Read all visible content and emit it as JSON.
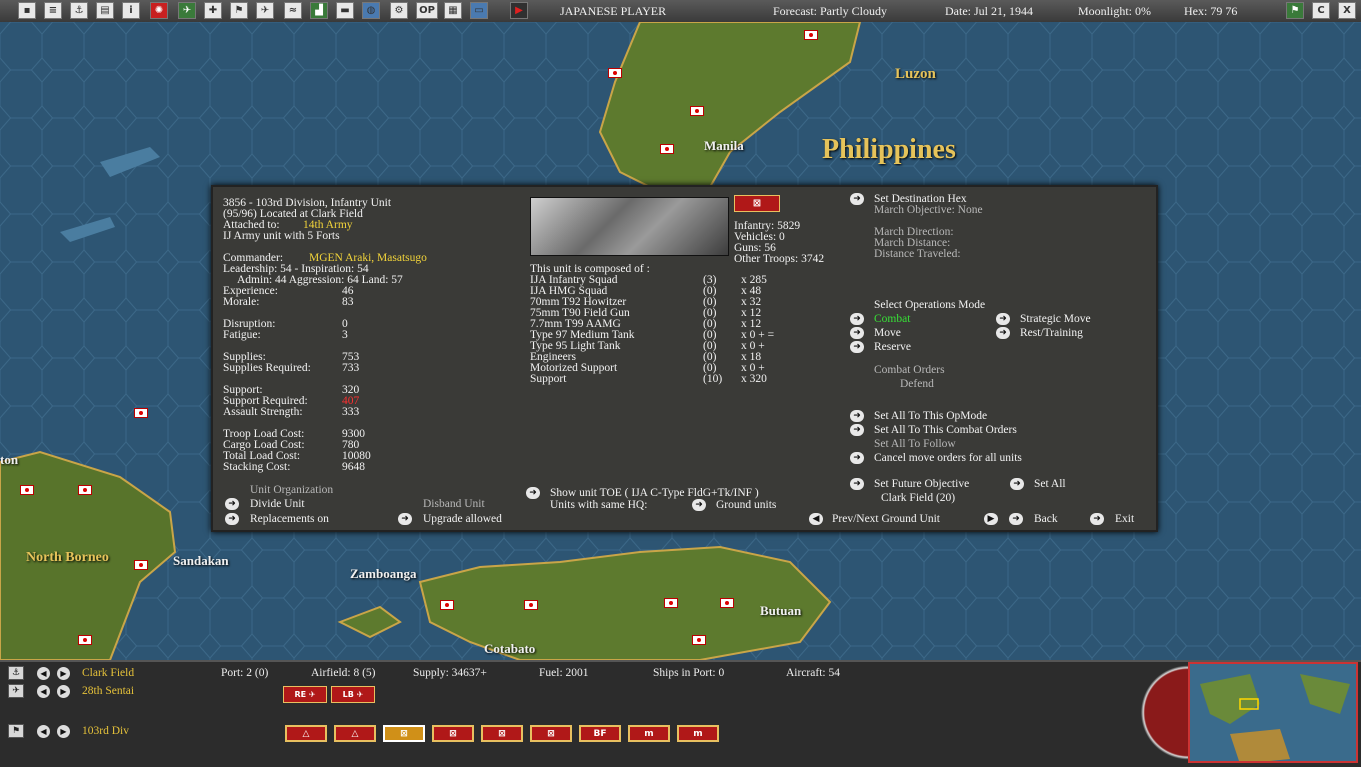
{
  "topbar": {
    "side": "JAPANESE PLAYER",
    "forecast": "Forecast: Partly Cloudy",
    "date": "Date: Jul 21, 1944",
    "moonlight": "Moonlight: 0%",
    "hex": "Hex: 79  76",
    "right_buttons": [
      "C",
      "X"
    ]
  },
  "map": {
    "region_large": "Philippines",
    "region_small": "Luzon",
    "north_borneo": "North Borneo",
    "cities": {
      "manila": "Manila",
      "sandakan": "Sandakan",
      "zamboanga": "Zamboanga",
      "butuan": "Butuan",
      "cotabato": "Cotabato",
      "ton": "ton"
    }
  },
  "unit": {
    "header": "3856 - 103rd Division, Infantry Unit",
    "location": "(95/96) Located at Clark Field",
    "attached_label": "Attached to:",
    "attached_value": "14th Army",
    "army_unit": "IJ Army unit with 5 Forts",
    "commander_label": "Commander:",
    "commander_value": "MGEN Araki, Masatsugo",
    "leadership": "Leadership: 54 - Inspiration: 54",
    "admin": "Admin: 44  Aggression: 64  Land: 57",
    "stats": [
      {
        "label": "Experience:",
        "value": "46"
      },
      {
        "label": "Morale:",
        "value": "83"
      },
      {
        "label": "Disruption:",
        "value": "0"
      },
      {
        "label": "Fatigue:",
        "value": "3"
      },
      {
        "label": "Supplies:",
        "value": "753"
      },
      {
        "label": "Supplies Required:",
        "value": "733"
      },
      {
        "label": "Support:",
        "value": "320"
      },
      {
        "label": "Support Required:",
        "value": "407"
      },
      {
        "label": "Assault Strength:",
        "value": "333"
      },
      {
        "label": "Troop Load Cost:",
        "value": "9300"
      },
      {
        "label": "Cargo Load Cost:",
        "value": "780"
      },
      {
        "label": "Total Load Cost:",
        "value": "10080"
      },
      {
        "label": "Stacking Cost:",
        "value": "9648"
      }
    ],
    "org_heading": "Unit Organization",
    "divide_unit": "Divide Unit",
    "disband_unit": "Disband Unit",
    "replacements": "Replacements on",
    "upgrade": "Upgrade allowed",
    "totals": [
      "Infantry: 5829",
      "Vehicles: 0",
      "Guns: 56",
      "Other Troops: 3742"
    ],
    "composed_heading": "This unit is composed of :",
    "composition": [
      {
        "name": "IJA Infantry Squad",
        "dis": "(3)",
        "qty": "x 285"
      },
      {
        "name": "IJA HMG Squad",
        "dis": "(0)",
        "qty": "x 48"
      },
      {
        "name": "70mm T92 Howitzer",
        "dis": "(0)",
        "qty": "x 32"
      },
      {
        "name": "75mm T90 Field Gun",
        "dis": "(0)",
        "qty": "x 12"
      },
      {
        "name": "7.7mm T99 AAMG",
        "dis": "(0)",
        "qty": "x 12"
      },
      {
        "name": "Type 97 Medium Tank",
        "dis": "(0)",
        "qty": "x 0 + ="
      },
      {
        "name": "Type 95 Light Tank",
        "dis": "(0)",
        "qty": "x 0 +"
      },
      {
        "name": "Engineers",
        "dis": "(0)",
        "qty": "x 18"
      },
      {
        "name": "Motorized Support",
        "dis": "(0)",
        "qty": "x 0 +"
      },
      {
        "name": "Support",
        "dis": "(10)",
        "qty": "x 320"
      }
    ],
    "show_toe": "Show unit TOE ( IJA C-Type FldG+Tk/INF )",
    "same_hq": "Units with same HQ:",
    "ground_units": "Ground units"
  },
  "orders": {
    "set_dest": "Set Destination Hex",
    "march_obj": "March Objective: None",
    "march_dir": "March Direction:",
    "march_dist": "March Distance:",
    "dist_trav": "Distance Traveled:",
    "select_mode": "Select Operations Mode",
    "combat": "Combat",
    "strategic": "Strategic Move",
    "move": "Move",
    "rest": "Rest/Training",
    "reserve": "Reserve",
    "combat_orders": "Combat Orders",
    "defend": "Defend",
    "set_all_opmode": "Set All To This OpMode",
    "set_all_combat": "Set All To This Combat Orders",
    "set_all_follow": "Set All To Follow",
    "cancel_move": "Cancel move orders for all units",
    "future_obj": "Set Future Objective",
    "set_all": "Set All",
    "clark_field": "Clark Field (20)",
    "prev_next": "Prev/Next Ground Unit",
    "back": "Back",
    "exit": "Exit"
  },
  "bottom": {
    "base": "Clark Field",
    "air_unit": "28th Sentai",
    "ground_unit": "103rd Div",
    "port": "Port: 2 (0)",
    "airfield": "Airfield: 8 (5)",
    "supply": "Supply: 34637+",
    "fuel": "Fuel: 2001",
    "ships": "Ships in Port: 0",
    "aircraft": "Aircraft: 54",
    "air_boxes": [
      "RE",
      "LB"
    ],
    "ground_boxes": [
      "△",
      "△",
      "⊠",
      "⊠",
      "⊠",
      "⊠",
      "BF",
      "m",
      "m"
    ]
  },
  "colors": {
    "accent_yellow": "#f2d43a",
    "combat_green": "#37e037",
    "alert_red": "#ff3030",
    "panel_bg": "#3a3a37"
  }
}
